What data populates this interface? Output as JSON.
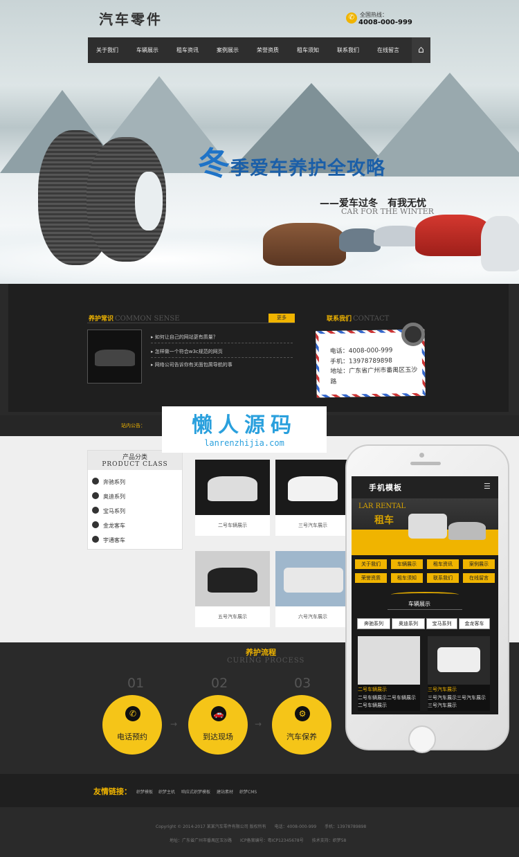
{
  "header": {
    "logo": "汽车零件",
    "hotline_label": "全国热线：",
    "hotline_number": "4008-000-999"
  },
  "nav": {
    "items": [
      "关于我们",
      "车辆展示",
      "租车资讯",
      "案例展示",
      "荣誉资质",
      "租车须知",
      "联系我们",
      "在线留言"
    ]
  },
  "banner": {
    "title_big": "冬",
    "title": "季爱车养护全攻略",
    "subtitle": "——爱车过冬　有我无忧",
    "subtitle_en": "CAR FOR THE WINTER"
  },
  "sense": {
    "title": "养护常识",
    "title_en": "COMMON SENSE",
    "more": "更多",
    "news": [
      "如何让自己的网站更有质量？",
      "怎样做一个符合w3c规范的网页",
      "网络公司告诉你有关面包屑导航的事"
    ]
  },
  "contact": {
    "title": "联系我们",
    "title_en": "CONTACT",
    "phone": "电话：4008-000-999",
    "mobile": "手机：13978789898",
    "address": "地址：广东省广州市番禺区玉沙路"
  },
  "notice": {
    "label": "站内公告："
  },
  "watermark": {
    "cn": "懒人源码",
    "url": "lanrenzhijia.com"
  },
  "categories": {
    "title": "产品分类",
    "title_en": "PRODUCT CLASS",
    "items": [
      "奔驰系列",
      "奥迪系列",
      "宝马系列",
      "金龙客车",
      "宇通客车"
    ]
  },
  "products": [
    {
      "caption": "二号车辆展示"
    },
    {
      "caption": "三号汽车展示"
    },
    {
      "caption": "五号汽车展示"
    },
    {
      "caption": "六号汽车展示"
    }
  ],
  "process": {
    "title": "养护流程",
    "title_en": "CURING PROCESS",
    "steps": [
      {
        "num": "01",
        "label": "电话预约"
      },
      {
        "num": "02",
        "label": "到达现场"
      },
      {
        "num": "03",
        "label": "汽车保养"
      }
    ]
  },
  "links": {
    "label": "友情链接：",
    "items": [
      "织梦模板",
      "织梦主机",
      "响应式织梦模板",
      "建站素材",
      "织梦CMS"
    ]
  },
  "footer": {
    "line1": "Copyright © 2014-2017 某某汽车零件有限公司 版权所有　　电话：4008-000-999　　手机：13978789898",
    "line2": "地址：广东省广州市番禺区玉沙路　　ICP备案编号：粤ICP12345678号　　技术支持：织梦58"
  },
  "mobile": {
    "title": "手机模板",
    "banner_en": "LAR RENTAL",
    "banner_cn": "租车",
    "menu": [
      "关于我们",
      "车辆展示",
      "租车资讯",
      "案例展示",
      "荣誉资质",
      "租车须知",
      "联系我们",
      "在线留言"
    ],
    "section": "车辆展示",
    "tabs": [
      "奔驰系列",
      "奥迪系列",
      "宝马系列",
      "金龙客车"
    ],
    "products": [
      {
        "title": "二号车辆展示",
        "desc": "二号车辆展示二号车辆展示二号车辆展示"
      },
      {
        "title": "三号汽车展示",
        "desc": "三号汽车展示三号汽车展示三号汽车展示"
      }
    ]
  }
}
